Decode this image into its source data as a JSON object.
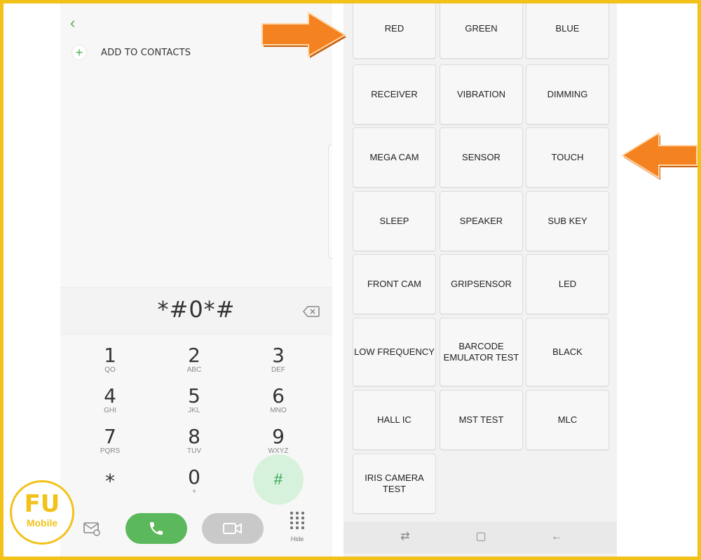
{
  "dialer": {
    "add_contacts_label": "ADD TO CONTACTS",
    "dialed_number": "*#0*#",
    "keys": [
      {
        "digit": "1",
        "letters": "QO"
      },
      {
        "digit": "2",
        "letters": "ABC"
      },
      {
        "digit": "3",
        "letters": "DEF"
      },
      {
        "digit": "4",
        "letters": "GHI"
      },
      {
        "digit": "5",
        "letters": "JKL"
      },
      {
        "digit": "6",
        "letters": "MNO"
      },
      {
        "digit": "7",
        "letters": "PQRS"
      },
      {
        "digit": "8",
        "letters": "TUV"
      },
      {
        "digit": "9",
        "letters": "WXYZ"
      },
      {
        "digit": "*",
        "letters": ""
      },
      {
        "digit": "0",
        "letters": "+"
      },
      {
        "digit": "#",
        "letters": ""
      }
    ],
    "hide_label": "Hide",
    "accent_color": "#4caf50"
  },
  "test_menu": {
    "tiles": [
      "RED",
      "GREEN",
      "BLUE",
      "RECEIVER",
      "VIBRATION",
      "DIMMING",
      "MEGA CAM",
      "SENSOR",
      "TOUCH",
      "SLEEP",
      "SPEAKER",
      "SUB KEY",
      "FRONT CAM",
      "GRIPSENSOR",
      "LED",
      "LOW FREQUENCY",
      "BARCODE\nEMULATOR TEST",
      "BLACK",
      "HALL IC",
      "MST TEST",
      "MLC",
      "IRIS CAMERA TEST"
    ]
  },
  "logo": {
    "line1": "FU",
    "line2": "Mobile",
    "color": "#f2c21a"
  },
  "arrow_color": "#f58220"
}
